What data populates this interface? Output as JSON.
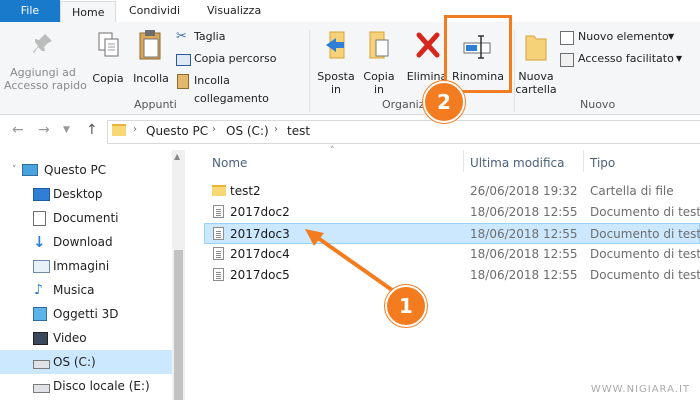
{
  "tabs": {
    "file": "File",
    "home": "Home",
    "share": "Condividi",
    "view": "Visualizza"
  },
  "ribbon": {
    "pin_quick_access": "Aggiungi ad\nAccesso rapido",
    "copy": "Copia",
    "paste": "Incolla",
    "cut": "Taglia",
    "copy_path": "Copia percorso",
    "paste_shortcut": "Incolla collegamento",
    "group_clipboard": "Appunti",
    "move_to": "Sposta",
    "move_to_2": "in",
    "copy_to": "Copia",
    "copy_to_2": "in",
    "delete": "Elimina",
    "rename": "Rinomina",
    "group_organize": "Organiz",
    "new_folder": "Nuova",
    "new_folder_2": "cartella",
    "new_item": "Nuovo elemento",
    "easy_access": "Accesso facilitato",
    "group_new": "Nuovo"
  },
  "address": {
    "crumbs": [
      "Questo PC",
      "OS (C:)",
      "test"
    ]
  },
  "nav_pane": {
    "items": [
      {
        "label": "Questo PC",
        "icon": "pc-icon"
      },
      {
        "label": "Desktop",
        "icon": "desktop-icon"
      },
      {
        "label": "Documenti",
        "icon": "documents-icon"
      },
      {
        "label": "Download",
        "icon": "download-icon"
      },
      {
        "label": "Immagini",
        "icon": "pictures-icon"
      },
      {
        "label": "Musica",
        "icon": "music-icon"
      },
      {
        "label": "Oggetti 3D",
        "icon": "objects3d-icon"
      },
      {
        "label": "Video",
        "icon": "video-icon"
      },
      {
        "label": "OS (C:)",
        "icon": "drive-icon"
      },
      {
        "label": "Disco locale (E:)",
        "icon": "drive-icon"
      }
    ]
  },
  "file_list": {
    "columns": {
      "name": "Nome",
      "modified": "Ultima modifica",
      "type": "Tipo"
    },
    "rows": [
      {
        "name": "test2",
        "modified": "26/06/2018 19:32",
        "type": "Cartella di file",
        "kind": "folder"
      },
      {
        "name": "2017doc2",
        "modified": "18/06/2018 12:55",
        "type": "Documento di testo",
        "kind": "file"
      },
      {
        "name": "2017doc3",
        "modified": "18/06/2018 12:55",
        "type": "Documento di testo",
        "kind": "file"
      },
      {
        "name": "2017doc4",
        "modified": "18/06/2018 12:55",
        "type": "Documento di testo",
        "kind": "file"
      },
      {
        "name": "2017doc5",
        "modified": "18/06/2018 12:55",
        "type": "Documento di testo",
        "kind": "file"
      }
    ]
  },
  "annotations": {
    "step1": "1",
    "step2": "2"
  },
  "watermark": "WWW.NIGIARA.IT",
  "colors": {
    "file_tab": "#1979ca",
    "accent_orange": "#f47c20",
    "selection": "#cce8ff"
  }
}
